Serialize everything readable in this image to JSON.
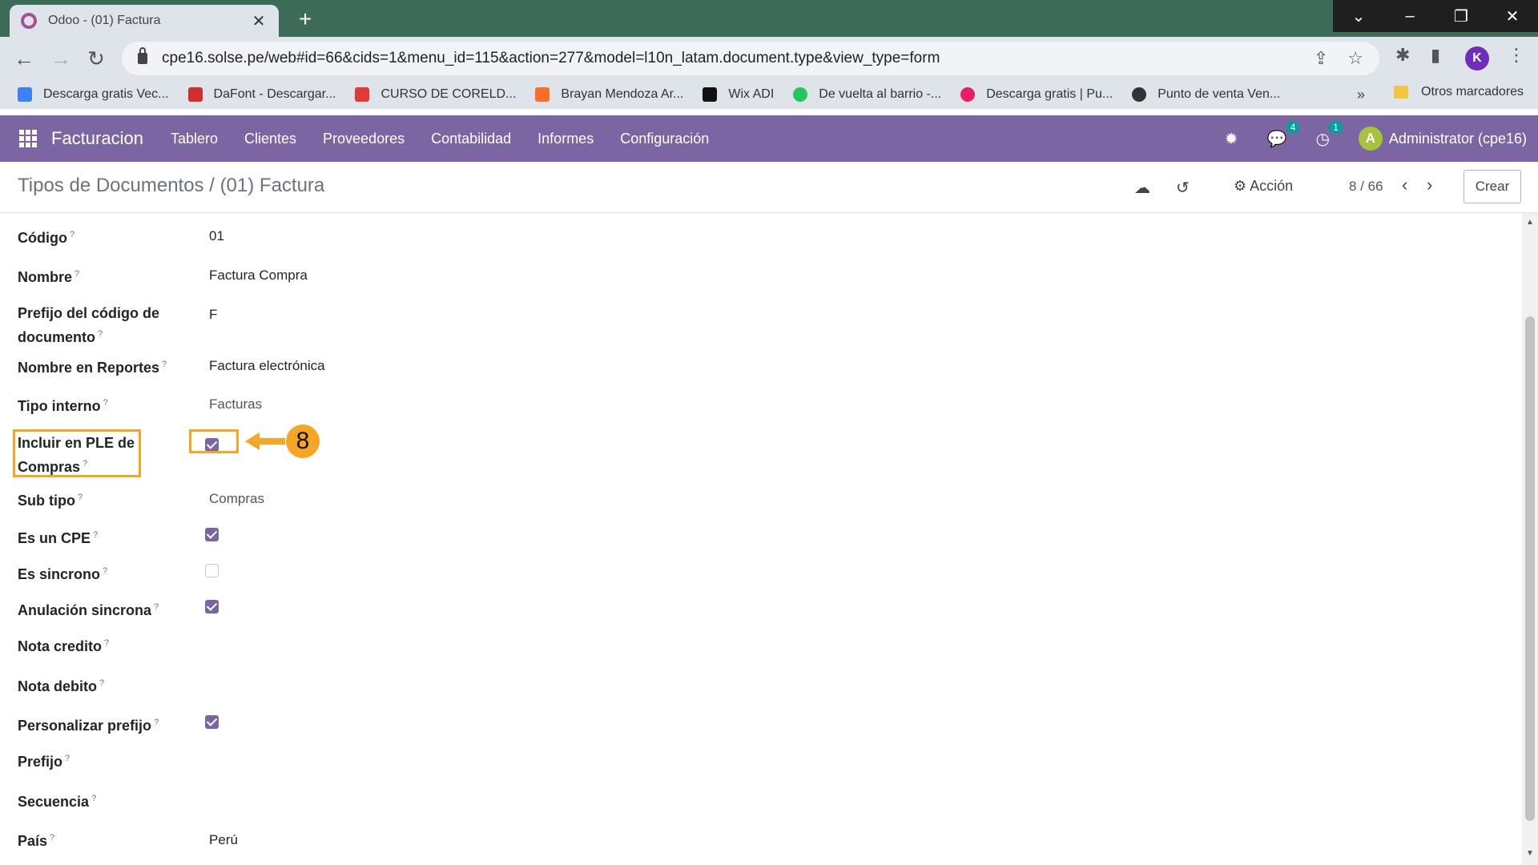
{
  "browser": {
    "tab_title": "Odoo - (01) Factura",
    "url": "cpe16.solse.pe/web#id=66&cids=1&menu_id=115&action=277&model=l10n_latam.document.type&view_type=form",
    "profile_initial": "K"
  },
  "bookmarks": [
    {
      "label": "Descarga gratis Vec...",
      "color": "#3b82f6"
    },
    {
      "label": "DaFont - Descargar...",
      "color": "#d32f2f"
    },
    {
      "label": "CURSO DE CORELD...",
      "color": "#e53935"
    },
    {
      "label": "Brayan Mendoza Ar...",
      "color": "#fc6d26"
    },
    {
      "label": "Wix ADI",
      "color": "#111111"
    },
    {
      "label": "De vuelta al barrio -...",
      "color": "#22c55e"
    },
    {
      "label": "Descarga gratis | Pu...",
      "color": "#e91e63"
    },
    {
      "label": "Punto de venta Ven...",
      "color": "#333333"
    }
  ],
  "bookmarks_more": "»",
  "bookmarks_folder": "Otros marcadores",
  "navbar": {
    "app_name": "Facturacion",
    "menu": [
      "Tablero",
      "Clientes",
      "Proveedores",
      "Contabilidad",
      "Informes",
      "Configuración"
    ],
    "messages_badge": "4",
    "activities_badge": "1",
    "avatar_initial": "A",
    "user": "Administrator (cpe16)"
  },
  "control": {
    "breadcrumb": "Tipos de Documentos / (01) Factura",
    "action_label": "Acción",
    "pager": "8 / 66",
    "create_label": "Crear"
  },
  "form": {
    "codigo": {
      "label": "Código",
      "value": "01"
    },
    "nombre": {
      "label": "Nombre",
      "value": "Factura Compra"
    },
    "prefijo_codigo": {
      "label_line1": "Prefijo del código de",
      "label_line2": "documento",
      "value": "F"
    },
    "nombre_reportes": {
      "label": "Nombre en Reportes",
      "value": "Factura electrónica"
    },
    "tipo_interno": {
      "label": "Tipo interno",
      "value": "Facturas"
    },
    "incluir_ple": {
      "label_line1": "Incluir en PLE de",
      "label_line2": "Compras",
      "checked": true
    },
    "sub_tipo": {
      "label": "Sub tipo",
      "value": "Compras"
    },
    "es_cpe": {
      "label": "Es un CPE",
      "checked": true
    },
    "es_sincrono": {
      "label": "Es sincrono",
      "checked": false
    },
    "anulacion_sincrona": {
      "label": "Anulación sincrona",
      "checked": true
    },
    "nota_credito": {
      "label": "Nota credito"
    },
    "nota_debito": {
      "label": "Nota debito"
    },
    "personalizar_prefijo": {
      "label": "Personalizar prefijo",
      "checked": true
    },
    "prefijo": {
      "label": "Prefijo"
    },
    "secuencia": {
      "label": "Secuencia"
    },
    "pais": {
      "label": "País",
      "value": "Perú"
    },
    "help_mark": "?"
  },
  "annotation": {
    "step": "8",
    "color": "#f5a623"
  }
}
